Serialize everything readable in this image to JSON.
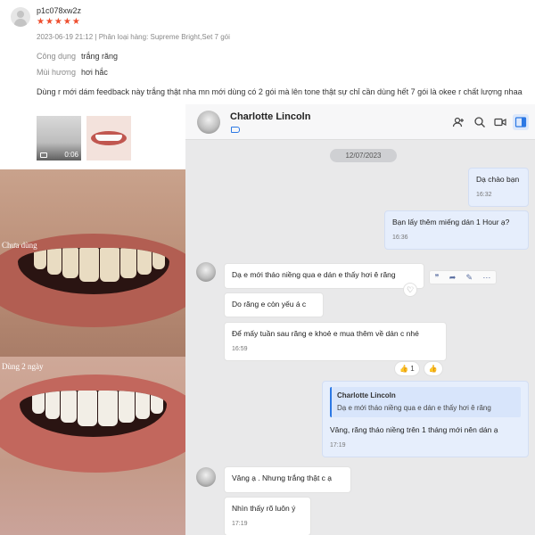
{
  "review": {
    "username": "p1c078xw2z",
    "stars": "★★★★★",
    "meta": "2023-06-19 21:12 | Phân loại hàng: Supreme Bright,Set 7 gói",
    "usage_label": "Công dụng",
    "usage_value": "trắng răng",
    "scent_label": "Mùi hương",
    "scent_value": "hơi hắc",
    "text": "Dùng r mới dám feedback này trắng thật nha mn mới dùng có 2 gói mà lên tone thật sự chỉ cần dùng hết 7 gói là okee r chất lượng nhaa",
    "video_duration": "0:06"
  },
  "photos": {
    "before_label": "Chưa dùng",
    "after_label": "Dùng 2 ngày"
  },
  "chat": {
    "contact_name": "Charlotte Lincoln",
    "date": "12/07/2023",
    "messages": [
      {
        "text": "Dạ chào bạn",
        "time": "16:32"
      },
      {
        "text": "Bạn lấy thêm miếng dán 1 Hour ạ?",
        "time": "16:36"
      },
      {
        "text": "Dạ e mới tháo niềng qua e dán e thấy hơi ê răng"
      },
      {
        "text": "Do răng e còn yếu á c"
      },
      {
        "text": "Để mấy tuần sau răng e khoẻ e mua thêm về dán c nhé",
        "time": "16:59"
      },
      {
        "text": "Vâng, răng tháo niềng trên 1 tháng mới nên dán ạ",
        "time": "17:19",
        "quote_name": "Charlotte Lincoln",
        "quote_text": "Dạ e mới tháo niềng qua e dán e thấy hơi ê răng"
      },
      {
        "text": "Vâng ạ . Nhưng trắng thật c ạ"
      },
      {
        "text": "Nhìn thấy rõ luôn ý",
        "time": "17:19"
      }
    ],
    "reaction_count": "1",
    "reaction_emoji": "👍",
    "colors": {
      "accent": "#2b78e4",
      "outgoing": "#e6eefc",
      "background": "#e9e9ea"
    }
  }
}
